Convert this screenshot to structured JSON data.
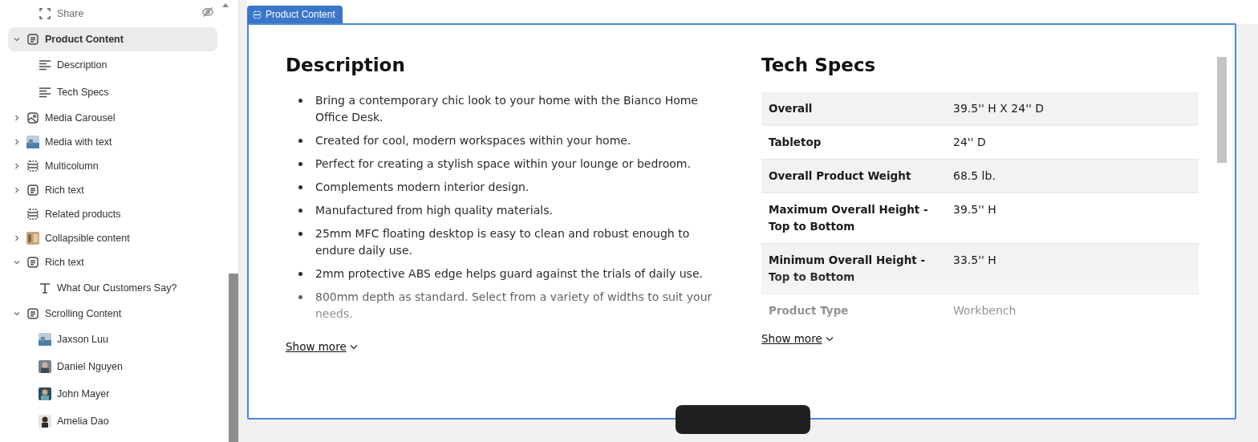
{
  "sidebar": {
    "items": [
      {
        "children": [
          {
            "label": "Share",
            "kind": "share",
            "hidden": true
          }
        ]
      },
      {
        "label": "Product Content",
        "kind": "section",
        "expanded": true,
        "selected": true,
        "children": [
          {
            "label": "Description",
            "kind": "lines"
          },
          {
            "label": "Tech Specs",
            "kind": "lines"
          }
        ]
      },
      {
        "label": "Media Carousel",
        "kind": "image",
        "expanded": false,
        "selected": false
      },
      {
        "label": "Media with text",
        "kind": "thumbblue",
        "expanded": false,
        "selected": false
      },
      {
        "label": "Multicolumn",
        "kind": "columns",
        "expanded": false,
        "selected": false
      },
      {
        "label": "Rich text",
        "kind": "section",
        "expanded": false,
        "selected": false
      },
      {
        "label": "Related products",
        "kind": "columns",
        "selected": false
      },
      {
        "label": "Collapsible content",
        "kind": "thumbbrown",
        "expanded": false,
        "selected": false
      },
      {
        "label": "Rich text",
        "kind": "section",
        "expanded": true,
        "selected": false,
        "children": [
          {
            "label": "What Our Customers Say?",
            "kind": "title"
          }
        ]
      },
      {
        "label": "Scrolling Content",
        "kind": "section",
        "expanded": true,
        "selected": false,
        "children": [
          {
            "label": "Jaxson Luu",
            "kind": "thumbblue"
          },
          {
            "label": "Daniel Nguyen",
            "kind": "thumbgrey"
          },
          {
            "label": "John Mayer",
            "kind": "thumbteal"
          },
          {
            "label": "Amelia Dao",
            "kind": "thumbperson"
          }
        ]
      }
    ]
  },
  "preview": {
    "frame_label": "Product Content",
    "description": {
      "title": "Description",
      "items": [
        "Bring a contemporary chic look to your home with the Bianco Home Office Desk.",
        "Created for cool, modern workspaces within your home.",
        "Perfect for creating a stylish space within your lounge or bedroom.",
        "Complements modern interior design.",
        "Manufactured from high quality materials.",
        "25mm MFC floating desktop is easy to clean and robust enough to endure daily use.",
        "2mm protective ABS edge helps guard against the trials of daily use.",
        "800mm depth as standard. Select from a variety of widths to suit your needs."
      ],
      "show_more": "Show more"
    },
    "tech_specs": {
      "title": "Tech Specs",
      "rows": [
        {
          "name": "Overall",
          "value": "39.5'' H X 24'' D"
        },
        {
          "name": "Tabletop",
          "value": "24'' D"
        },
        {
          "name": "Overall Product Weight",
          "value": "68.5 lb."
        },
        {
          "name": "Maximum Overall Height - Top to Bottom",
          "value": "39.5'' H"
        },
        {
          "name": "Minimum Overall Height - Top to Bottom",
          "value": "33.5'' H"
        },
        {
          "name": "Product Type",
          "value": "Workbench"
        }
      ],
      "show_more": "Show more"
    }
  }
}
